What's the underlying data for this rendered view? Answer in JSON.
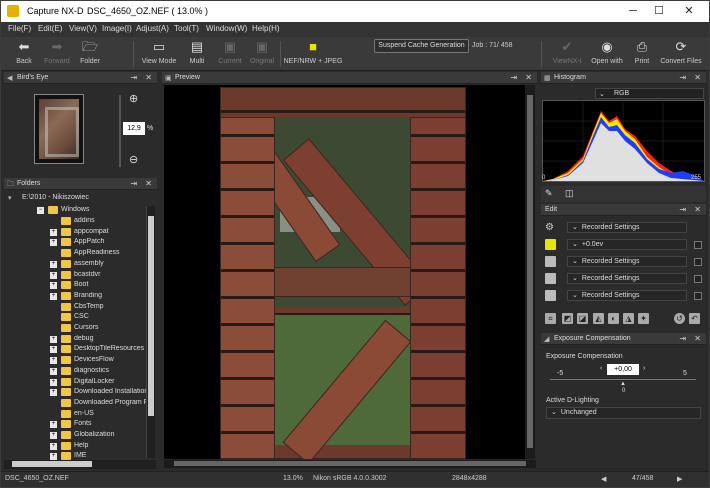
{
  "app": {
    "title": "Capture NX-D",
    "document": "DSC_4650_OZ.NEF ( 13.0% )"
  },
  "window_controls": {
    "minimize": "─",
    "maximize": "☐",
    "close": "✕"
  },
  "menu": [
    "File(F)",
    "Edit(E)",
    "View(V)",
    "Image(I)",
    "Adjust(A)",
    "Tool(T)",
    "Window(W)",
    "Help(H)"
  ],
  "toolbar": {
    "back": "Back",
    "forward": "Forward",
    "folder": "Folder",
    "view_mode": "View Mode",
    "multi": "Multi",
    "current": "Current",
    "original": "Original",
    "format": "NEF/NRW + JPEG",
    "cache_button": "Suspend Cache Generation",
    "job_label": "Job :",
    "job_value": "71/  458",
    "viewnx": "ViewNX-i",
    "open_with": "Open with",
    "print": "Print",
    "convert": "Convert Files"
  },
  "birds_eye": {
    "title": "Bird's Eye",
    "zoom_value": "12,9",
    "zoom_unit": "%"
  },
  "folders": {
    "title": "Folders",
    "drive": "E:\\2010 - Nikiszowiec",
    "root": "Windows",
    "items": [
      {
        "label": "addins",
        "exp": false
      },
      {
        "label": "appcompat",
        "exp": true
      },
      {
        "label": "AppPatch",
        "exp": true
      },
      {
        "label": "AppReadiness",
        "exp": false
      },
      {
        "label": "assembly",
        "exp": true
      },
      {
        "label": "bcastdvr",
        "exp": true
      },
      {
        "label": "Boot",
        "exp": true
      },
      {
        "label": "Branding",
        "exp": true
      },
      {
        "label": "CbsTemp",
        "exp": false
      },
      {
        "label": "CSC",
        "exp": false
      },
      {
        "label": "Cursors",
        "exp": false
      },
      {
        "label": "debug",
        "exp": true
      },
      {
        "label": "DesktopTileResources",
        "exp": true
      },
      {
        "label": "DevicesFlow",
        "exp": true
      },
      {
        "label": "diagnostics",
        "exp": true
      },
      {
        "label": "DigitalLocker",
        "exp": true
      },
      {
        "label": "Downloaded Installations",
        "exp": true
      },
      {
        "label": "Downloaded Program Files",
        "exp": false
      },
      {
        "label": "en-US",
        "exp": false
      },
      {
        "label": "Fonts",
        "exp": true
      },
      {
        "label": "Globalization",
        "exp": true
      },
      {
        "label": "Help",
        "exp": true
      },
      {
        "label": "IME",
        "exp": true
      }
    ]
  },
  "preview": {
    "title": "Preview"
  },
  "histogram": {
    "title": "Histogram",
    "channel": "RGB",
    "min": "0",
    "max": "255"
  },
  "edit": {
    "title": "Edit",
    "rows": [
      {
        "label": "Recorded Settings"
      },
      {
        "label": "+0.0ev"
      },
      {
        "label": "Recorded Settings"
      },
      {
        "label": "Recorded Settings"
      },
      {
        "label": "Recorded Settings"
      }
    ]
  },
  "exposure": {
    "title": "Exposure Compensation",
    "label": "Exposure Compensation",
    "value": "+0,00",
    "min": "-5",
    "max": "5",
    "zero": "0",
    "adl_label": "Active D-Lighting",
    "adl_value": "Unchanged"
  },
  "status": {
    "filename": "DSC_4650_OZ.NEF",
    "zoom": "13.0%",
    "profile": "Nikon sRGB 4.0.0.3002",
    "dimensions": "2848x4288",
    "counter": "47/458"
  }
}
